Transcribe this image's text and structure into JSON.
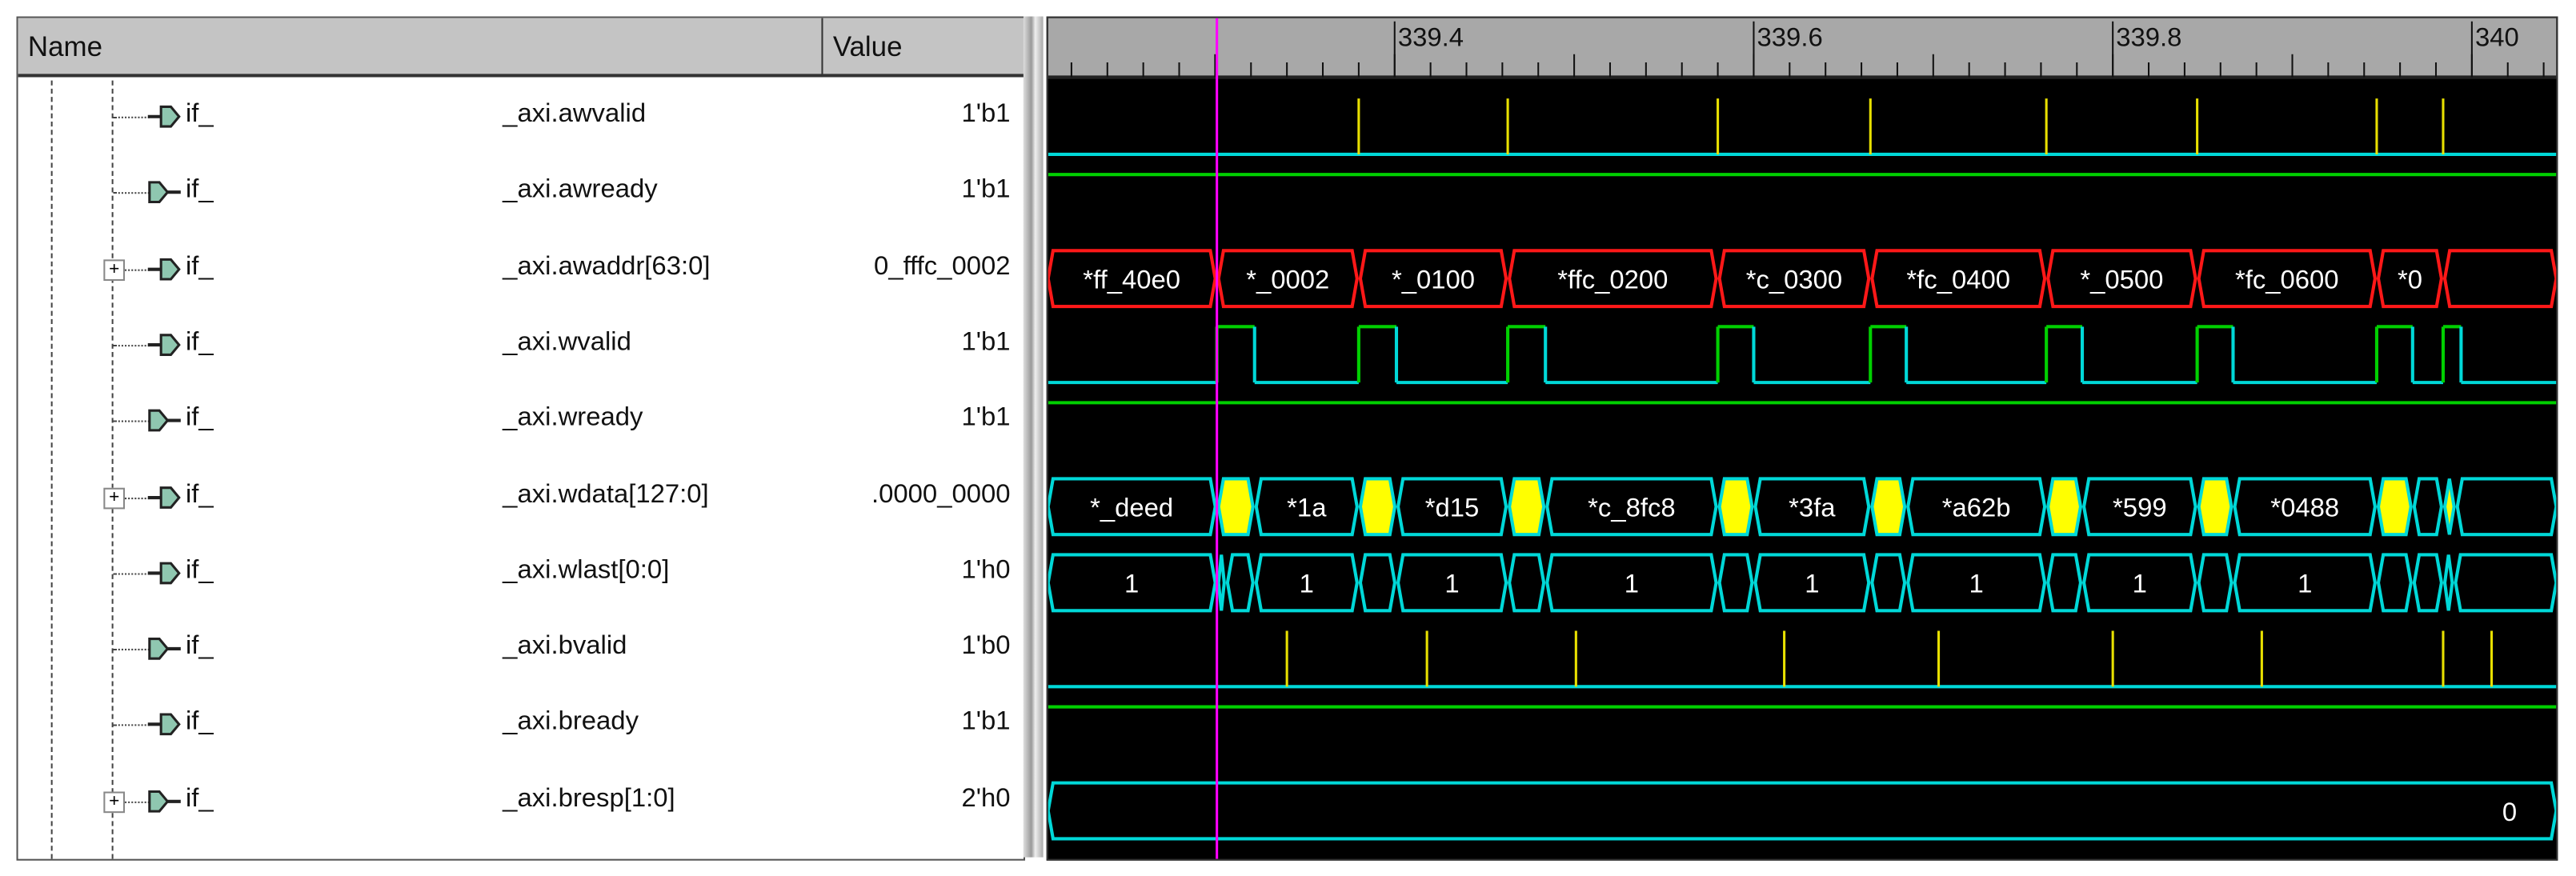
{
  "header": {
    "name_label": "Name",
    "value_label": "Value"
  },
  "signals": [
    {
      "scope": "if_",
      "name": "_axi.awvalid",
      "value": "1'b1",
      "expandable": false,
      "icon": "input-port-icon"
    },
    {
      "scope": "if_",
      "name": "_axi.awready",
      "value": "1'b1",
      "expandable": false,
      "icon": "output-port-icon"
    },
    {
      "scope": "if_",
      "name": "_axi.awaddr[63:0]",
      "value": "0_fffc_0002",
      "expandable": true,
      "icon": "input-port-icon"
    },
    {
      "scope": "if_",
      "name": "_axi.wvalid",
      "value": "1'b1",
      "expandable": false,
      "icon": "input-port-icon"
    },
    {
      "scope": "if_",
      "name": "_axi.wready",
      "value": "1'b1",
      "expandable": false,
      "icon": "output-port-icon"
    },
    {
      "scope": "if_",
      "name": "_axi.wdata[127:0]",
      "value": ".0000_0000",
      "expandable": true,
      "icon": "input-port-icon"
    },
    {
      "scope": "if_",
      "name": "_axi.wlast[0:0]",
      "value": "1'h0",
      "expandable": false,
      "icon": "input-port-icon"
    },
    {
      "scope": "if_",
      "name": "_axi.bvalid",
      "value": "1'b0",
      "expandable": false,
      "icon": "output-port-icon"
    },
    {
      "scope": "if_",
      "name": "_axi.bready",
      "value": "1'b1",
      "expandable": false,
      "icon": "input-port-icon"
    },
    {
      "scope": "if_",
      "name": "_axi.bresp[1:0]",
      "value": "2'h0",
      "expandable": true,
      "icon": "output-port-icon"
    }
  ],
  "colors": {
    "high": "#00d000",
    "low": "#00d8d8",
    "bus_addr": "#ff1818",
    "pulse": "#e8e000",
    "xfill": "#ffff00",
    "cursor": "#ff00ff",
    "ruler": "#a8a8a8"
  },
  "chart_data": {
    "type": "waveform",
    "time_range": [
      339.207,
      340.047
    ],
    "cursor_time": 339.301,
    "ruler_labels": [
      {
        "t": 339.4,
        "label": "339.4"
      },
      {
        "t": 339.6,
        "label": "339.6"
      },
      {
        "t": 339.8,
        "label": "339.8"
      },
      {
        "t": 340.0,
        "label": "340"
      }
    ],
    "minor_tick_step": 0.02,
    "major_tick_step": 0.1,
    "waves": [
      {
        "signal": "awvalid",
        "kind": "pulse",
        "times": [
          339.38,
          339.463,
          339.58,
          339.665,
          339.763,
          339.847,
          339.947,
          339.984
        ]
      },
      {
        "signal": "awready",
        "kind": "const_high"
      },
      {
        "signal": "awaddr",
        "kind": "bus",
        "color": "bus_addr",
        "segments": [
          {
            "t0": 339.207,
            "t1": 339.301,
            "label": "*ff_40e0"
          },
          {
            "t0": 339.301,
            "t1": 339.38,
            "label": "*_0002"
          },
          {
            "t0": 339.38,
            "t1": 339.463,
            "label": "*_0100"
          },
          {
            "t0": 339.463,
            "t1": 339.58,
            "label": "*ffc_0200"
          },
          {
            "t0": 339.58,
            "t1": 339.665,
            "label": "*c_0300"
          },
          {
            "t0": 339.665,
            "t1": 339.763,
            "label": "*fc_0400"
          },
          {
            "t0": 339.763,
            "t1": 339.847,
            "label": "*_0500"
          },
          {
            "t0": 339.847,
            "t1": 339.947,
            "label": "*fc_0600"
          },
          {
            "t0": 339.947,
            "t1": 339.984,
            "label": "*0"
          },
          {
            "t0": 339.984,
            "t1": 340.047,
            "label": ""
          }
        ]
      },
      {
        "signal": "wvalid",
        "kind": "clock",
        "high": [
          [
            339.301,
            339.322
          ],
          [
            339.38,
            339.401
          ],
          [
            339.463,
            339.484
          ],
          [
            339.58,
            339.6
          ],
          [
            339.665,
            339.685
          ],
          [
            339.763,
            339.783
          ],
          [
            339.847,
            339.867
          ],
          [
            339.947,
            339.967
          ],
          [
            339.984,
            339.994
          ]
        ]
      },
      {
        "signal": "wready",
        "kind": "const_high"
      },
      {
        "signal": "wdata",
        "kind": "bus",
        "color": "low",
        "segments": [
          {
            "t0": 339.207,
            "t1": 339.301,
            "label": "*_deed"
          },
          {
            "t0": 339.301,
            "t1": 339.322,
            "label": "",
            "x": true
          },
          {
            "t0": 339.322,
            "t1": 339.38,
            "label": "*1a"
          },
          {
            "t0": 339.38,
            "t1": 339.401,
            "label": "",
            "x": true
          },
          {
            "t0": 339.401,
            "t1": 339.463,
            "label": "*d15"
          },
          {
            "t0": 339.463,
            "t1": 339.484,
            "label": "",
            "x": true
          },
          {
            "t0": 339.484,
            "t1": 339.58,
            "label": "*c_8fc8"
          },
          {
            "t0": 339.58,
            "t1": 339.6,
            "label": "",
            "x": true
          },
          {
            "t0": 339.6,
            "t1": 339.665,
            "label": "*3fa"
          },
          {
            "t0": 339.665,
            "t1": 339.685,
            "label": "",
            "x": true
          },
          {
            "t0": 339.685,
            "t1": 339.763,
            "label": "*a62b"
          },
          {
            "t0": 339.763,
            "t1": 339.783,
            "label": "",
            "x": true
          },
          {
            "t0": 339.783,
            "t1": 339.847,
            "label": "*599"
          },
          {
            "t0": 339.847,
            "t1": 339.867,
            "label": "",
            "x": true
          },
          {
            "t0": 339.867,
            "t1": 339.947,
            "label": "*0488"
          },
          {
            "t0": 339.947,
            "t1": 339.967,
            "label": "",
            "x": true
          },
          {
            "t0": 339.967,
            "t1": 339.984,
            "label": ""
          },
          {
            "t0": 339.984,
            "t1": 339.991,
            "label": "",
            "x": true
          },
          {
            "t0": 339.991,
            "t1": 340.047,
            "label": ""
          }
        ]
      },
      {
        "signal": "wlast",
        "kind": "bus",
        "color": "low",
        "segments": [
          {
            "t0": 339.207,
            "t1": 339.301,
            "label": "1"
          },
          {
            "t0": 339.301,
            "t1": 339.306,
            "label": ""
          },
          {
            "t0": 339.306,
            "t1": 339.322,
            "label": ""
          },
          {
            "t0": 339.322,
            "t1": 339.38,
            "label": "1"
          },
          {
            "t0": 339.38,
            "t1": 339.401,
            "label": ""
          },
          {
            "t0": 339.401,
            "t1": 339.463,
            "label": "1"
          },
          {
            "t0": 339.463,
            "t1": 339.484,
            "label": ""
          },
          {
            "t0": 339.484,
            "t1": 339.58,
            "label": "1"
          },
          {
            "t0": 339.58,
            "t1": 339.6,
            "label": ""
          },
          {
            "t0": 339.6,
            "t1": 339.665,
            "label": "1"
          },
          {
            "t0": 339.665,
            "t1": 339.685,
            "label": ""
          },
          {
            "t0": 339.685,
            "t1": 339.763,
            "label": "1"
          },
          {
            "t0": 339.763,
            "t1": 339.783,
            "label": ""
          },
          {
            "t0": 339.783,
            "t1": 339.847,
            "label": "1"
          },
          {
            "t0": 339.847,
            "t1": 339.867,
            "label": ""
          },
          {
            "t0": 339.867,
            "t1": 339.947,
            "label": "1"
          },
          {
            "t0": 339.947,
            "t1": 339.967,
            "label": ""
          },
          {
            "t0": 339.967,
            "t1": 339.984,
            "label": ""
          },
          {
            "t0": 339.984,
            "t1": 339.99,
            "label": ""
          },
          {
            "t0": 339.99,
            "t1": 340.047,
            "label": ""
          }
        ]
      },
      {
        "signal": "bvalid",
        "kind": "pulse",
        "times": [
          339.34,
          339.418,
          339.501,
          339.617,
          339.703,
          339.8,
          339.883,
          339.984,
          340.011
        ]
      },
      {
        "signal": "bready",
        "kind": "const_high"
      },
      {
        "signal": "bresp",
        "kind": "bus",
        "color": "low",
        "segments": [
          {
            "t0": 339.207,
            "t1": 340.047,
            "label": "0",
            "label_at": 340.021
          }
        ]
      }
    ]
  }
}
